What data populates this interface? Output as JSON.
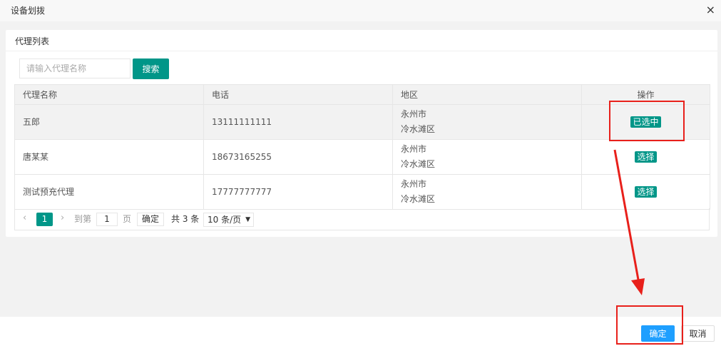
{
  "dialog": {
    "title": "设备划拨",
    "close_symbol": "×"
  },
  "card": {
    "title": "代理列表"
  },
  "search": {
    "placeholder": "请输入代理名称",
    "button_label": "搜索"
  },
  "table": {
    "columns": [
      "代理名称",
      "电话",
      "地区",
      "操作"
    ],
    "rows": [
      {
        "name": "五郎",
        "phone": "13111111111",
        "region_line1": "永州市",
        "region_line2": "冷水滩区",
        "action": "已选中",
        "selected": true
      },
      {
        "name": "唐某某",
        "phone": "18673165255",
        "region_line1": "永州市",
        "region_line2": "冷水滩区",
        "action": "选择",
        "selected": false
      },
      {
        "name": "测试预充代理",
        "phone": "17777777777",
        "region_line1": "永州市",
        "region_line2": "冷水滩区",
        "action": "选择",
        "selected": false
      }
    ]
  },
  "pagination": {
    "prev_symbol": "‹",
    "next_symbol": "›",
    "current_page": "1",
    "goto_label": "到第",
    "goto_value": "1",
    "page_unit": "页",
    "go_button": "确定",
    "total_text": "共 3 条",
    "page_size": "10 条/页",
    "caret": "▼"
  },
  "footer": {
    "confirm_label": "确定",
    "cancel_label": "取消"
  },
  "colors": {
    "primary_green": "#009688",
    "confirm_blue": "#1e9fff",
    "annotation_red": "#e8201b"
  }
}
